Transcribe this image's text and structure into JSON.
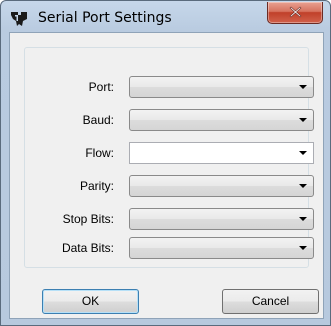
{
  "window": {
    "title": "Serial Port Settings",
    "app_icon": "ti-logo-icon",
    "close_icon": "close-icon"
  },
  "form": {
    "fields": [
      {
        "label": "Port:",
        "value": "",
        "style": "dropdown"
      },
      {
        "label": "Baud:",
        "value": "",
        "style": "dropdown"
      },
      {
        "label": "Flow:",
        "value": "",
        "style": "dropdown-editable"
      },
      {
        "label": "Parity:",
        "value": "",
        "style": "dropdown"
      },
      {
        "label": "Stop Bits:",
        "value": "",
        "style": "dropdown"
      },
      {
        "label": "Data Bits:",
        "value": "",
        "style": "dropdown"
      }
    ]
  },
  "buttons": {
    "ok_label": "OK",
    "cancel_label": "Cancel"
  },
  "colors": {
    "title_bar": "#c6d7ea",
    "client_bg": "#f0f0f0",
    "close_button": "#c0402a"
  }
}
